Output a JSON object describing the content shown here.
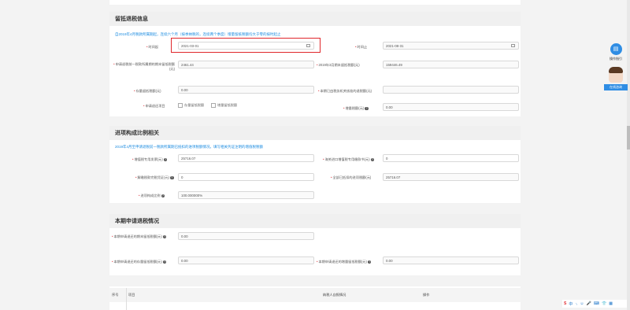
{
  "sections": {
    "retained": {
      "title": "留抵退税信息",
      "note": "自2019年4月税款所属期起，连续六个月（按季纳税的，连续两个季度）增量留抵税额均大于零的按时起止",
      "start_label": "时间起",
      "start_value": "2021-03-01",
      "end_label": "时间止",
      "end_value": "2021-08-31",
      "apply_label": "申请退税前一税款所属期的期末留抵税额(元)",
      "apply_value": "2461.44",
      "march_label": "2019年3月期末留抵税额(元)",
      "march_value": "159446.49",
      "stock_label": "存量留抵税额(元)",
      "stock_value": "0.00",
      "period_label": "本期已由税务机关核准的退税额(元)",
      "period_value": "",
      "options_label": "申请退还项目",
      "option1": "存量留抵税额",
      "option2": "增量留抵税额",
      "increment_label": "增量税额(元)",
      "increment_value": "0.00"
    },
    "input": {
      "title": "进项构成比例相关",
      "note": "2019年4月至申请退税前一税款所属期已抵扣的进项税额情况，填写相关凭证注明的增值税税额",
      "vat_label": "增值税专用发票(元)",
      "vat_value": "25716.07",
      "customs_label": "海关进口增值税专用缴款书(元)",
      "customs_value": "0",
      "tax_label": "解缴税款完税凭证(元)",
      "tax_value": "0",
      "total_label": "全部已抵扣的进项税额(元)",
      "total_value": "25716.07",
      "ratio_label": "进项构成比例",
      "ratio_value": "100.000000%"
    },
    "current": {
      "title": "本期申请退税情况",
      "endperiod_label": "本期申请退还的期末留抵税额(元)",
      "endperiod_value": "0.00",
      "stock_label": "本期申请退还的存量留抵税额(元)",
      "stock_value": "0.00",
      "incr_label": "本期申请退还的增量留抵税额(元)",
      "incr_value": "0.00"
    },
    "table": {
      "headers": [
        "序号",
        "项目",
        "纳税人自报情况",
        "操作"
      ]
    }
  },
  "right_tools": {
    "guide": "操作指引",
    "consult": "在线咨询"
  },
  "taskbar": [
    "S",
    "中",
    "·,",
    "☺",
    "🎤",
    "⌨",
    "👕",
    "▦"
  ]
}
